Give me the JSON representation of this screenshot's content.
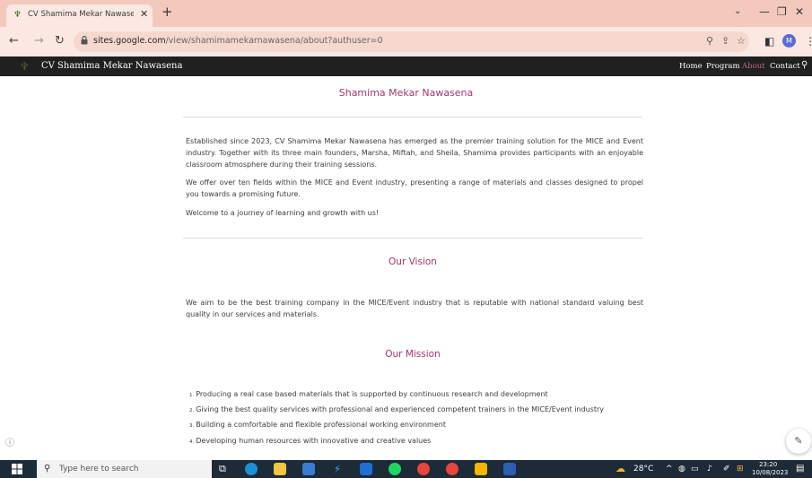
{
  "browser": {
    "tab_title": "CV Shamima Mekar Nawasena - About",
    "tab_close": "✕",
    "new_tab": "+",
    "window_minimize": "—",
    "window_restore": "❐",
    "window_close": "✕",
    "url_host": "sites.google.com",
    "url_path": "/view/shamimamekarnawasena/about?authuser=0",
    "profile_initial": "M"
  },
  "site": {
    "title": "CV Shamima Mekar Nawasena",
    "nav": [
      {
        "label": "Home"
      },
      {
        "label": "Program"
      },
      {
        "label": "About"
      },
      {
        "label": "Contact"
      }
    ]
  },
  "about": {
    "brand_title": "Shamima Mekar Nawasena",
    "paragraphs": [
      "Established since 2023, CV Shamima Mekar Nawasena has emerged as the premier training solution for the MICE and Event industry. Together with its three main founders, Marsha, Miftah, and Sheila, Shamima provides participants with an enjoyable classroom atmosphere during their training sessions.",
      "We offer over ten fields within the MICE and Event industry, presenting a range of materials and classes designed to propel you towards a promising future.",
      "Welcome to a journey of learning and growth with us!"
    ]
  },
  "vision": {
    "title": "Our Vision",
    "text": "We aim to be the best training company in the MICE/Event industry that is reputable with national standard valuing best quality in our services and materials."
  },
  "mission": {
    "title": "Our Mission",
    "items": [
      {
        "num": "1.",
        "text": "Producing a real case based materials that is supported by continuous research and development"
      },
      {
        "num": "2.",
        "text": "Giving the best quality services with professional and experienced competent trainers in the MICE/Event industry"
      },
      {
        "num": "3.",
        "text": "Building a comfortable and flexible professional working environment"
      },
      {
        "num": "4.",
        "text": "Developing human resources with innovative and creative values"
      }
    ]
  },
  "taskbar": {
    "search_placeholder": "Type here to search",
    "temperature": "28°C",
    "time": "23:20",
    "date": "10/08/2023"
  },
  "colors": {
    "tab_bar": "#f3c9bd",
    "site_header": "#202020",
    "accent": "#a0366e",
    "taskbar": "#1d2a38"
  }
}
